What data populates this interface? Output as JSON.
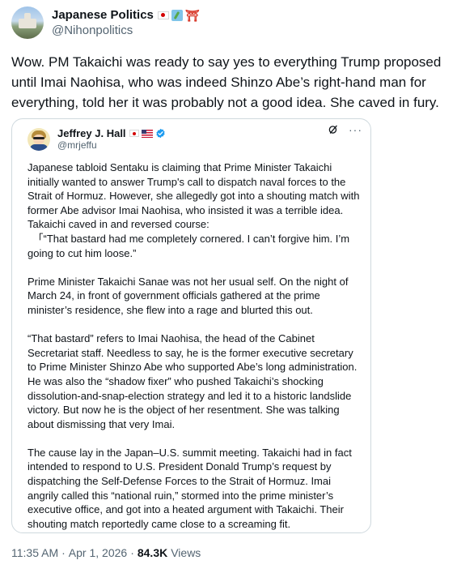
{
  "header": {
    "display_name": "Japanese Politics",
    "handle": "@Nihonpolitics",
    "emoji_icons": [
      "japan-flag",
      "japan-map",
      "torii-gate"
    ]
  },
  "tweet": {
    "text": "Wow. PM Takaichi was ready to say yes to everything Trump proposed until Imai Naohisa, who was indeed Shinzo Abe’s right-hand man for everything, told her it was probably not a good idea. She caved in fury."
  },
  "quote": {
    "display_name": "Jeffrey J. Hall",
    "handle": "@mrjeffu",
    "flag_icons": [
      "japan-flag",
      "us-flag"
    ],
    "verified_color": "#1d9bf0",
    "more_label": "···",
    "paragraphs": [
      "Japanese tabloid Sentaku is claiming that Prime Minister Takaichi initially wanted to answer Trump's call to dispatch naval forces to the Strait of Hormuz. However, she allegedly got into a shouting match with former Abe advisor Imai Naohisa, who insisted it was a terrible idea.",
      "Takaichi caved in and reversed course:",
      "　「“That bastard had me completely cornered. I can’t forgive him. I’m going to cut him loose.”",
      "Prime Minister Takaichi Sanae was not her usual self. On the night of March 24, in front of government officials gathered at the prime minister’s residence, she flew into a rage and blurted this out.",
      "“That bastard” refers to Imai Naohisa, the head of the Cabinet Secretariat staff. Needless to say, he is the former executive secretary to Prime Minister Shinzo Abe who supported Abe’s long administration. He was also the “shadow fixer” who pushed Takaichi’s shocking dissolution-and-snap-election strategy and led it to a historic landslide victory. But now he is the object of her resentment. She was talking about dismissing that very Imai.",
      "The cause lay in the Japan–U.S. summit meeting. Takaichi had in fact intended to respond to U.S. President Donald Trump’s request by dispatching the Self-Defense Forces to the Strait of Hormuz. Imai angrily called this “national ruin,” stormed into the prime minister’s executive office, and got into a heated argument with Takaichi. Their shouting match reportedly came close to a screaming fit."
    ]
  },
  "meta": {
    "time": "11:35 AM",
    "separator": "·",
    "date": "Apr 1, 2026",
    "views_count": "84.3K",
    "views_label": "Views"
  }
}
